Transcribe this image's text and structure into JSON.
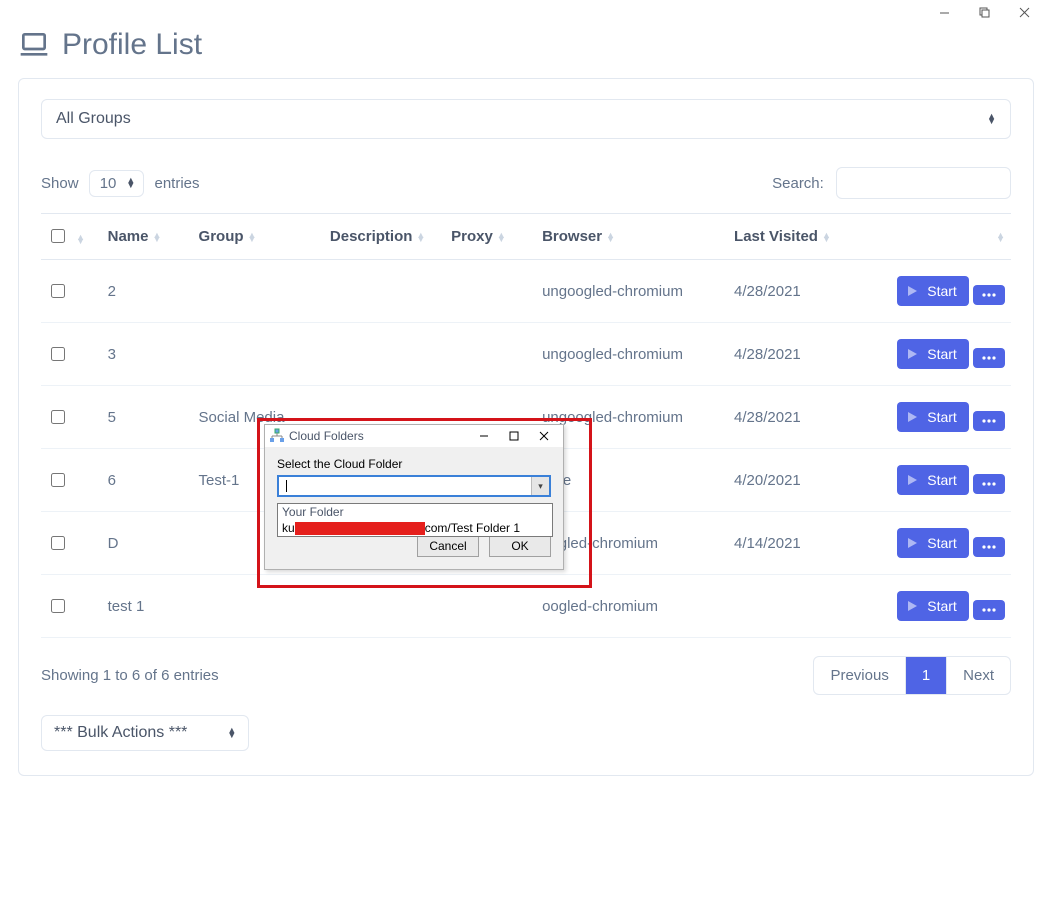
{
  "titlebar": {},
  "page": {
    "title": "Profile List",
    "group_select_value": "All Groups",
    "show_label_pre": "Show",
    "show_count": "10",
    "show_label_post": "entries",
    "search_label": "Search:",
    "info_text": "Showing 1 to 6 of 6 entries",
    "bulk_actions_label": "*** Bulk Actions ***"
  },
  "columns": {
    "check": "",
    "name": "Name",
    "group": "Group",
    "description": "Description",
    "proxy": "Proxy",
    "browser": "Browser",
    "last_visited": "Last Visited",
    "actions": ""
  },
  "rows": [
    {
      "name": "2",
      "group": "",
      "description": "",
      "proxy": "",
      "browser": "ungoogled-chromium",
      "last_visited": "4/28/2021"
    },
    {
      "name": "3",
      "group": "",
      "description": "",
      "proxy": "",
      "browser": "ungoogled-chromium",
      "last_visited": "4/28/2021"
    },
    {
      "name": "5",
      "group": "Social Media",
      "description": "",
      "proxy": "",
      "browser": "ungoogled-chromium",
      "last_visited": "4/28/2021"
    },
    {
      "name": "6",
      "group": "Test-1",
      "description": "",
      "proxy": "",
      "browser": "ome",
      "last_visited": "4/20/2021"
    },
    {
      "name": "D",
      "group": "",
      "description": "",
      "proxy": "",
      "browser": "oogled-chromium",
      "last_visited": "4/14/2021"
    },
    {
      "name": "test 1",
      "group": "",
      "description": "",
      "proxy": "",
      "browser": "oogled-chromium",
      "last_visited": ""
    }
  ],
  "buttons": {
    "start": "Start"
  },
  "pager": {
    "previous": "Previous",
    "page1": "1",
    "next": "Next"
  },
  "dialog": {
    "title": "Cloud Folders",
    "label": "Select the Cloud Folder",
    "option1": "Your Folder",
    "option2_prefix": "ku",
    "option2_suffix": "com/Test Folder 1",
    "cancel": "Cancel",
    "ok": "OK"
  }
}
